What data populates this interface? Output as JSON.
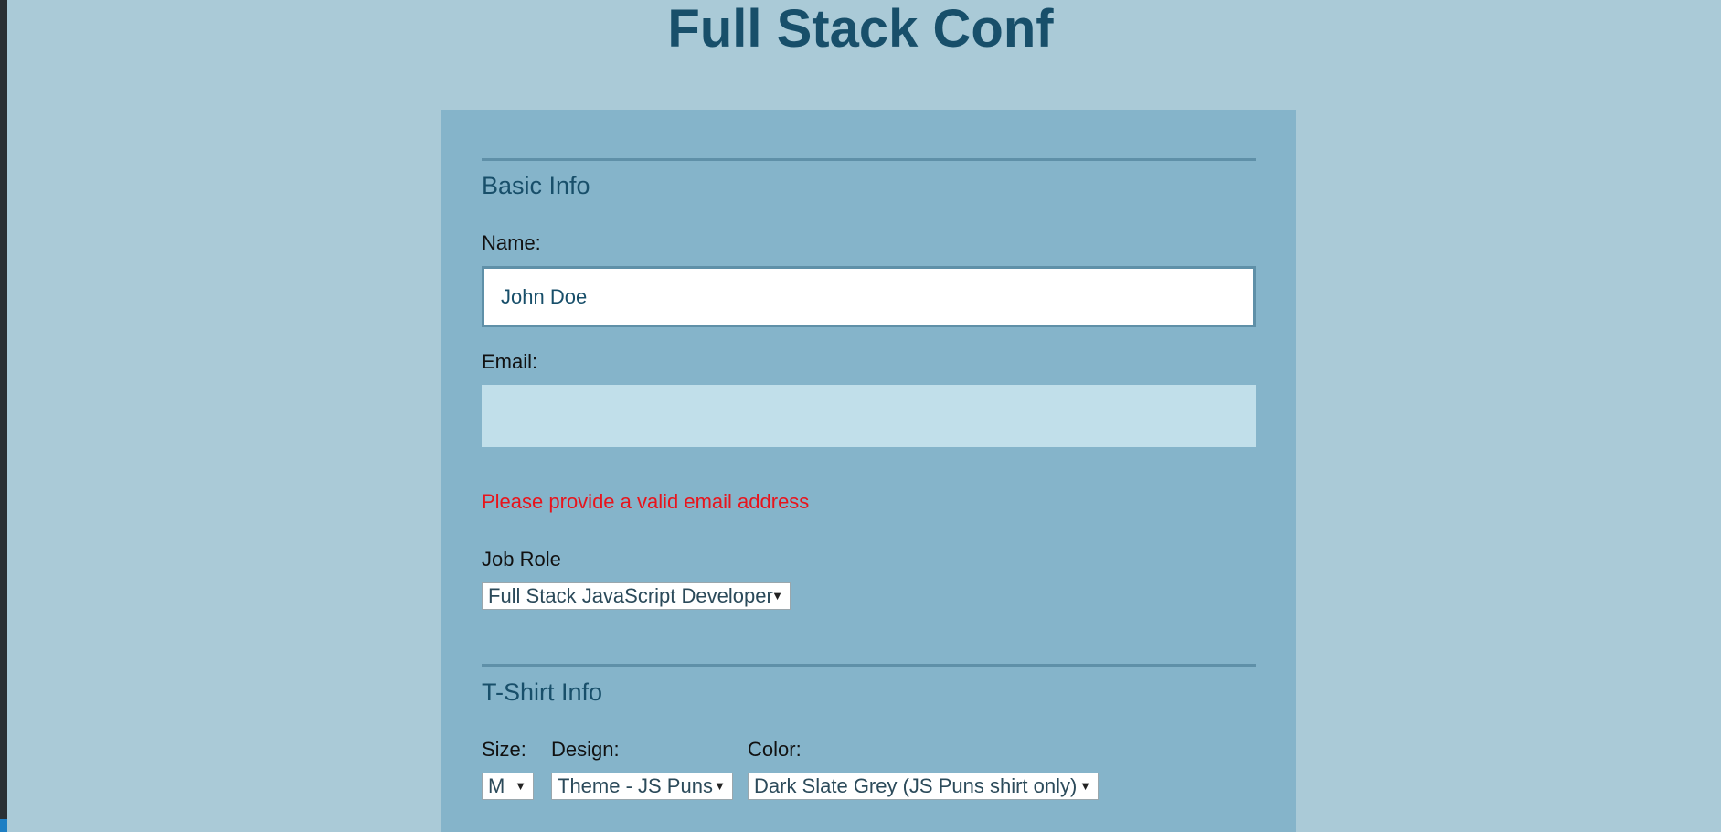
{
  "header": {
    "title": "Full Stack Conf"
  },
  "basic_info": {
    "heading": "Basic Info",
    "name_label": "Name:",
    "name_value": "John Doe",
    "email_label": "Email:",
    "email_value": "",
    "email_error": "Please provide a valid email address",
    "job_role_label": "Job Role",
    "job_role_selected": "Full Stack JavaScript Developer"
  },
  "tshirt_info": {
    "heading": "T-Shirt Info",
    "size_label": "Size:",
    "size_selected": "M",
    "design_label": "Design:",
    "design_selected": "Theme - JS Puns",
    "color_label": "Color:",
    "color_selected": "Dark Slate Grey (JS Puns shirt only)"
  },
  "colors": {
    "page_background": "#aacad7",
    "card_background": "#85b4ca",
    "heading": "#184f6a",
    "error": "#e8141c",
    "email_field_background": "#c1dfea"
  },
  "icons": {
    "select_arrow": "triangle-down-icon"
  }
}
